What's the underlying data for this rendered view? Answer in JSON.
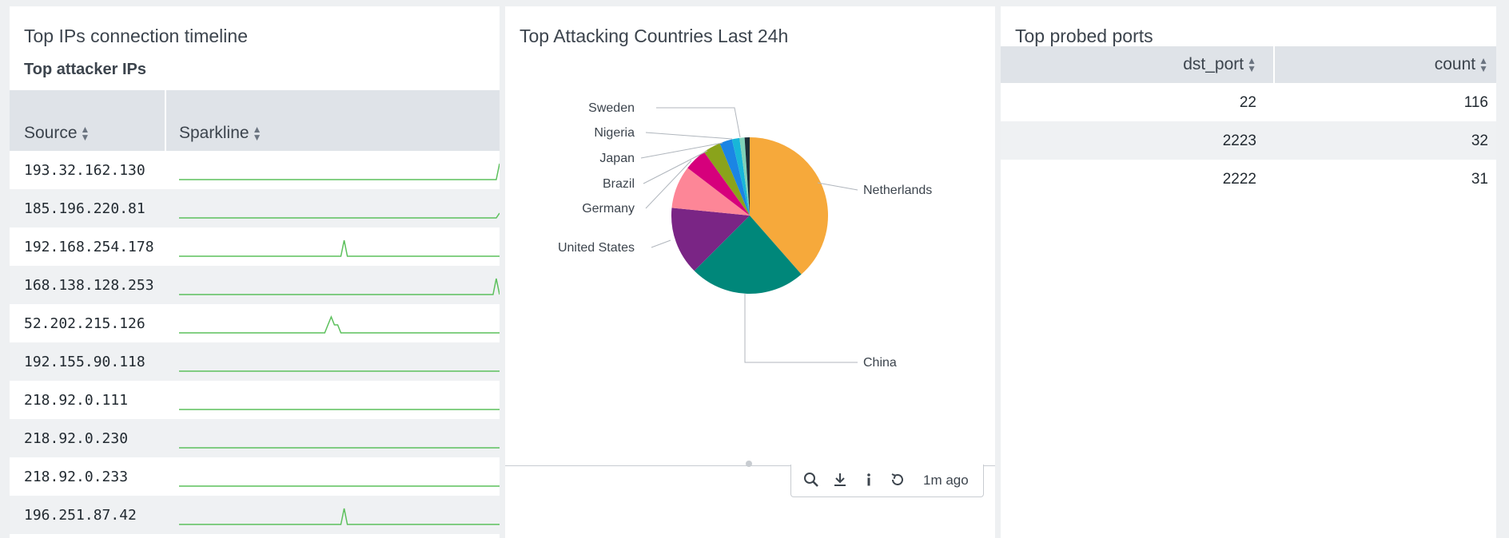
{
  "panels": {
    "timeline": {
      "title": "Top IPs connection timeline",
      "subtitle": "Top attacker IPs",
      "columns": [
        "Source",
        "Sparkline"
      ],
      "rows": [
        {
          "ip": "193.32.162.130",
          "spark": [
            0,
            0,
            0,
            0,
            0,
            0,
            0,
            0,
            0,
            0,
            0,
            0,
            0,
            0,
            0,
            0,
            0,
            0,
            0,
            0,
            0,
            0,
            0,
            0,
            0,
            0,
            0,
            0,
            0,
            0,
            0,
            0,
            0,
            0,
            0,
            0,
            0,
            0,
            0,
            0,
            0,
            0,
            0,
            0,
            0,
            0,
            0,
            0,
            0,
            0,
            0,
            0,
            0,
            0,
            0,
            0,
            0,
            0,
            0,
            0,
            0,
            0,
            0,
            0,
            0,
            0,
            0,
            0,
            0,
            0,
            0,
            0,
            0,
            0,
            0,
            0,
            0,
            0,
            0,
            0,
            0,
            0,
            0,
            0,
            0,
            0,
            0,
            0,
            0,
            0,
            0,
            0,
            0,
            0,
            0,
            0,
            0,
            0,
            0,
            1
          ]
        },
        {
          "ip": "185.196.220.81",
          "spark": [
            0,
            0,
            0,
            0,
            0,
            0,
            0,
            0,
            0,
            0,
            0,
            0,
            0,
            0,
            0,
            0,
            0,
            0,
            0,
            0,
            0,
            0,
            0,
            0,
            0,
            0,
            0,
            0,
            0,
            0,
            0,
            0,
            0,
            0,
            0,
            0,
            0,
            0,
            0,
            0,
            0,
            0,
            0,
            0,
            0,
            0,
            0,
            0,
            0,
            0,
            0,
            0,
            0,
            0,
            0,
            0,
            0,
            0,
            0,
            0,
            0,
            0,
            0,
            0,
            0,
            0,
            0,
            0,
            0,
            0,
            0,
            0,
            0,
            0,
            0,
            0,
            0,
            0,
            0,
            0,
            0,
            0,
            0,
            0,
            0,
            0,
            0,
            0,
            0,
            0,
            0,
            0,
            0,
            0,
            0,
            0,
            0,
            0,
            0,
            0.3
          ]
        },
        {
          "ip": "192.168.254.178",
          "spark": [
            0,
            0,
            0,
            0,
            0,
            0,
            0,
            0,
            0,
            0,
            0,
            0,
            0,
            0,
            0,
            0,
            0,
            0,
            0,
            0,
            0,
            0,
            0,
            0,
            0,
            0,
            0,
            0,
            0,
            0,
            0,
            0,
            0,
            0,
            0,
            0,
            0,
            0,
            0,
            0,
            0,
            0,
            0,
            0,
            0,
            0,
            0,
            0,
            0,
            0,
            0,
            1,
            0,
            0,
            0,
            0,
            0,
            0,
            0,
            0,
            0,
            0,
            0,
            0,
            0,
            0,
            0,
            0,
            0,
            0,
            0,
            0,
            0,
            0,
            0,
            0,
            0,
            0,
            0,
            0,
            0,
            0,
            0,
            0,
            0,
            0,
            0,
            0,
            0,
            0,
            0,
            0,
            0,
            0,
            0,
            0,
            0,
            0,
            0,
            0
          ]
        },
        {
          "ip": "168.138.128.253",
          "spark": [
            0,
            0,
            0,
            0,
            0,
            0,
            0,
            0,
            0,
            0,
            0,
            0,
            0,
            0,
            0,
            0,
            0,
            0,
            0,
            0,
            0,
            0,
            0,
            0,
            0,
            0,
            0,
            0,
            0,
            0,
            0,
            0,
            0,
            0,
            0,
            0,
            0,
            0,
            0,
            0,
            0,
            0,
            0,
            0,
            0,
            0,
            0,
            0,
            0,
            0,
            0,
            0,
            0,
            0,
            0,
            0,
            0,
            0,
            0,
            0,
            0,
            0,
            0,
            0,
            0,
            0,
            0,
            0,
            0,
            0,
            0,
            0,
            0,
            0,
            0,
            0,
            0,
            0,
            0,
            0,
            0,
            0,
            0,
            0,
            0,
            0,
            0,
            0,
            0,
            0,
            0,
            0,
            0,
            0,
            0,
            0,
            0,
            0,
            1,
            0
          ]
        },
        {
          "ip": "52.202.215.126",
          "spark": [
            0,
            0,
            0,
            0,
            0,
            0,
            0,
            0,
            0,
            0,
            0,
            0,
            0,
            0,
            0,
            0,
            0,
            0,
            0,
            0,
            0,
            0,
            0,
            0,
            0,
            0,
            0,
            0,
            0,
            0,
            0,
            0,
            0,
            0,
            0,
            0,
            0,
            0,
            0,
            0,
            0,
            0,
            0,
            0,
            0,
            0,
            0.5,
            1,
            0.5,
            0.5,
            0,
            0,
            0,
            0,
            0,
            0,
            0,
            0,
            0,
            0,
            0,
            0,
            0,
            0,
            0,
            0,
            0,
            0,
            0,
            0,
            0,
            0,
            0,
            0,
            0,
            0,
            0,
            0,
            0,
            0,
            0,
            0,
            0,
            0,
            0,
            0,
            0,
            0,
            0,
            0,
            0,
            0,
            0,
            0,
            0,
            0,
            0,
            0,
            0,
            0
          ]
        },
        {
          "ip": "192.155.90.118",
          "spark": [
            0,
            0,
            0,
            0,
            0,
            0,
            0,
            0,
            0,
            0,
            0,
            0,
            0,
            0,
            0,
            0,
            0,
            0,
            0,
            0,
            0,
            0,
            0,
            0,
            0,
            0,
            0,
            0,
            0,
            0,
            0,
            0,
            0,
            0,
            0,
            0,
            0,
            0,
            0,
            0,
            0,
            0,
            0,
            0,
            0,
            0,
            0,
            0,
            0,
            0,
            0,
            0,
            0,
            0,
            0,
            0,
            0,
            0,
            0,
            0,
            0,
            0,
            0,
            0,
            0,
            0,
            0,
            0,
            0,
            0,
            0,
            0,
            0,
            0,
            0,
            0,
            0,
            0,
            0,
            0,
            0,
            0,
            0,
            0,
            0,
            0,
            0,
            0,
            0,
            0,
            0,
            0,
            0,
            0,
            0,
            0,
            0,
            0,
            0,
            0
          ]
        },
        {
          "ip": "218.92.0.111",
          "spark": [
            0,
            0,
            0,
            0,
            0,
            0,
            0,
            0,
            0,
            0,
            0,
            0,
            0,
            0,
            0,
            0,
            0,
            0,
            0,
            0,
            0,
            0,
            0,
            0,
            0,
            0,
            0,
            0,
            0,
            0,
            0,
            0,
            0,
            0,
            0,
            0,
            0,
            0,
            0,
            0,
            0,
            0,
            0,
            0,
            0,
            0,
            0,
            0,
            0,
            0,
            0,
            0,
            0,
            0,
            0,
            0,
            0,
            0,
            0,
            0,
            0,
            0,
            0,
            0,
            0,
            0,
            0,
            0,
            0,
            0,
            0,
            0,
            0,
            0,
            0,
            0,
            0,
            0,
            0,
            0,
            0,
            0,
            0,
            0,
            0,
            0,
            0,
            0,
            0,
            0,
            0,
            0,
            0,
            0,
            0,
            0,
            0,
            0,
            0,
            0
          ]
        },
        {
          "ip": "218.92.0.230",
          "spark": [
            0,
            0,
            0,
            0,
            0,
            0,
            0,
            0,
            0,
            0,
            0,
            0,
            0,
            0,
            0,
            0,
            0,
            0,
            0,
            0,
            0,
            0,
            0,
            0,
            0,
            0,
            0,
            0,
            0,
            0,
            0,
            0,
            0,
            0,
            0,
            0,
            0,
            0,
            0,
            0,
            0,
            0,
            0,
            0,
            0,
            0,
            0,
            0,
            0,
            0,
            0,
            0,
            0,
            0,
            0,
            0,
            0,
            0,
            0,
            0,
            0,
            0,
            0,
            0,
            0,
            0,
            0,
            0,
            0,
            0,
            0,
            0,
            0,
            0,
            0,
            0,
            0,
            0,
            0,
            0,
            0,
            0,
            0,
            0,
            0,
            0,
            0,
            0,
            0,
            0,
            0,
            0,
            0,
            0,
            0,
            0,
            0,
            0,
            0,
            0
          ]
        },
        {
          "ip": "218.92.0.233",
          "spark": [
            0,
            0,
            0,
            0,
            0,
            0,
            0,
            0,
            0,
            0,
            0,
            0,
            0,
            0,
            0,
            0,
            0,
            0,
            0,
            0,
            0,
            0,
            0,
            0,
            0,
            0,
            0,
            0,
            0,
            0,
            0,
            0,
            0,
            0,
            0,
            0,
            0,
            0,
            0,
            0,
            0,
            0,
            0,
            0,
            0,
            0,
            0,
            0,
            0,
            0,
            0,
            0,
            0,
            0,
            0,
            0,
            0,
            0,
            0,
            0,
            0,
            0,
            0,
            0,
            0,
            0,
            0,
            0,
            0,
            0,
            0,
            0,
            0,
            0,
            0,
            0,
            0,
            0,
            0,
            0,
            0,
            0,
            0,
            0,
            0,
            0,
            0,
            0,
            0,
            0,
            0,
            0,
            0,
            0,
            0,
            0,
            0,
            0,
            0,
            0
          ]
        },
        {
          "ip": "196.251.87.42",
          "spark": [
            0,
            0,
            0,
            0,
            0,
            0,
            0,
            0,
            0,
            0,
            0,
            0,
            0,
            0,
            0,
            0,
            0,
            0,
            0,
            0,
            0,
            0,
            0,
            0,
            0,
            0,
            0,
            0,
            0,
            0,
            0,
            0,
            0,
            0,
            0,
            0,
            0,
            0,
            0,
            0,
            0,
            0,
            0,
            0,
            0,
            0,
            0,
            0,
            0,
            0,
            0,
            1,
            0,
            0,
            0,
            0,
            0,
            0,
            0,
            0,
            0,
            0,
            0,
            0,
            0,
            0,
            0,
            0,
            0,
            0,
            0,
            0,
            0,
            0,
            0,
            0,
            0,
            0,
            0,
            0,
            0,
            0,
            0,
            0,
            0,
            0,
            0,
            0,
            0,
            0,
            0,
            0,
            0,
            0,
            0,
            0,
            0,
            0,
            0,
            0
          ]
        }
      ],
      "spark_color": "#5cc05c"
    },
    "countries": {
      "title": "Top Attacking Countries Last 24h",
      "toolbar": {
        "icons": [
          "search-icon",
          "download-icon",
          "info-icon",
          "refresh-icon"
        ],
        "time": "1m ago"
      }
    },
    "ports": {
      "title": "Top probed ports",
      "columns": [
        "dst_port",
        "count"
      ],
      "rows": [
        {
          "dst_port": "22",
          "count": "116"
        },
        {
          "dst_port": "2223",
          "count": "32"
        },
        {
          "dst_port": "2222",
          "count": "31"
        }
      ]
    }
  },
  "chart_data": {
    "type": "pie",
    "title": "Top Attacking Countries Last 24h",
    "slices": [
      {
        "label": "Netherlands",
        "value": 37,
        "color": "#f6a93b"
      },
      {
        "label": "China",
        "value": 23,
        "color": "#00877a"
      },
      {
        "label": "United States",
        "value": 13.5,
        "color": "#7a2585"
      },
      {
        "label": "Germany",
        "value": 8.5,
        "color": "#fd8697"
      },
      {
        "label": "Brazil",
        "value": 4.5,
        "color": "#d6007c"
      },
      {
        "label": "Japan",
        "value": 3.5,
        "color": "#8aa31b"
      },
      {
        "label": "Nigeria",
        "value": 2.5,
        "color": "#1b85e4"
      },
      {
        "label": "Sweden",
        "value": 1.5,
        "color": "#18b6d8"
      },
      {
        "label": "",
        "value": 1.0,
        "color": "#7fd1b9"
      },
      {
        "label": "",
        "value": 1.0,
        "color": "#1d2d38"
      }
    ]
  }
}
